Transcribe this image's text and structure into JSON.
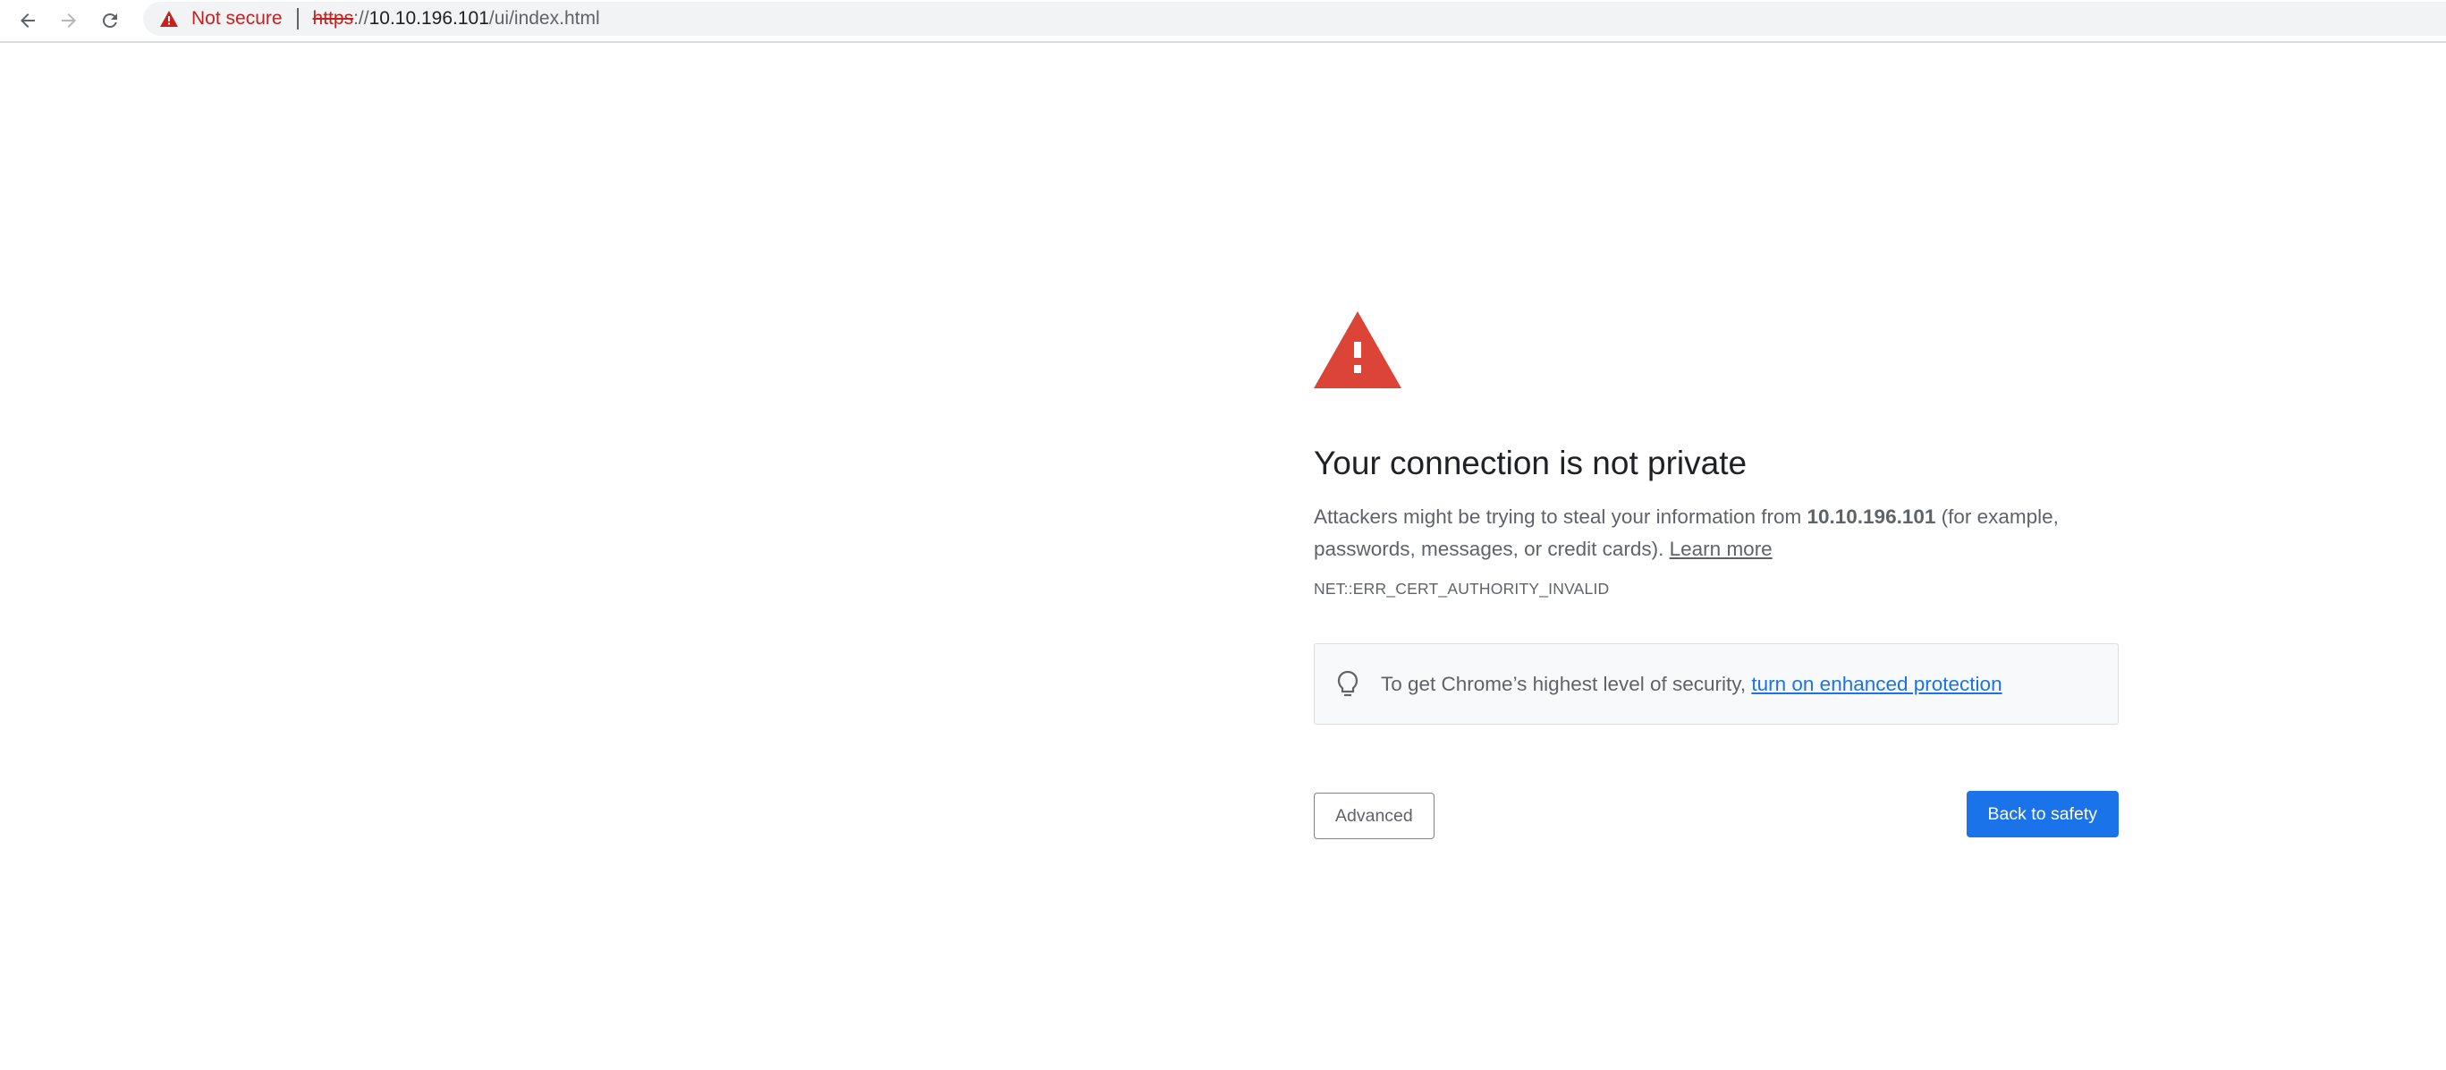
{
  "browser": {
    "security_label": "Not secure",
    "url": {
      "scheme": "https",
      "separator": "://",
      "host": "10.10.196.101",
      "path": "/ui/index.html"
    },
    "icons": {
      "back": "arrow-left-icon",
      "forward": "arrow-right-icon",
      "reload": "reload-icon",
      "security": "warning-triangle-icon"
    }
  },
  "interstitial": {
    "heading": "Your connection is not private",
    "description": {
      "part1": "Attackers might be trying to steal your information from ",
      "host": "10.10.196.101",
      "part2": " (for example, passwords, messages, or credit cards). ",
      "learn_more": "Learn more"
    },
    "error_code": "NET::ERR_CERT_AUTHORITY_INVALID",
    "enhanced": {
      "text": "To get Chrome’s highest level of security, ",
      "link": "turn on enhanced protection"
    },
    "buttons": {
      "advanced": "Advanced",
      "back_to_safety": "Back to safety"
    },
    "colors": {
      "warning_red": "#db4437",
      "link_blue": "#1a73e8",
      "primary_button": "#1a73e8",
      "insecure_red": "#c5221f"
    }
  }
}
